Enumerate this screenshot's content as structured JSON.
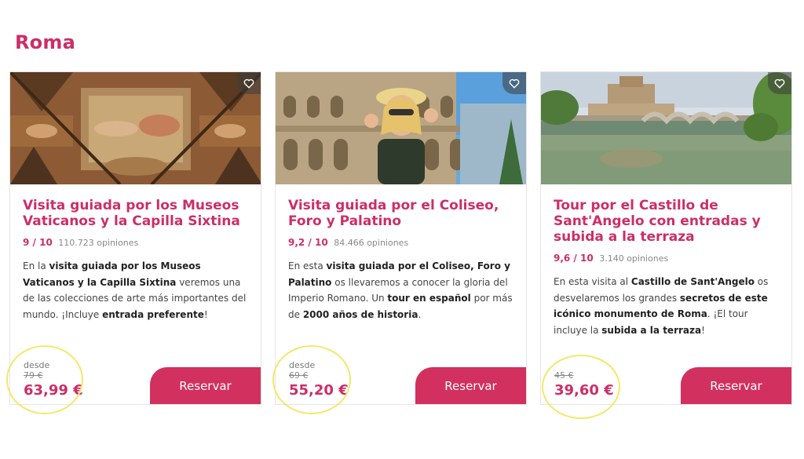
{
  "section": {
    "title": "Roma"
  },
  "cards": [
    {
      "title": "Visita guiada por los Museos Vaticanos y la Capilla Sixtina",
      "rating": "9 / 10",
      "reviews": "110.723 opiniones",
      "desc": [
        {
          "t": "En la ",
          "b": false
        },
        {
          "t": "visita guiada por los Museos Vaticanos y la Capilla Sixtina",
          "b": true
        },
        {
          "t": " veremos una de las colecciones de arte más importantes del mundo. ¡Incluye ",
          "b": false
        },
        {
          "t": "entrada preferente",
          "b": true
        },
        {
          "t": "!",
          "b": false
        }
      ],
      "price_from": "desde",
      "price_old": "79 €",
      "price_now": "63,99 €",
      "button": "Reservar"
    },
    {
      "title": "Visita guiada por el Coliseo, Foro y Palatino",
      "rating": "9,2 / 10",
      "reviews": "84.466 opiniones",
      "desc": [
        {
          "t": "En esta ",
          "b": false
        },
        {
          "t": "visita guiada por el Coliseo, Foro y Palatino",
          "b": true
        },
        {
          "t": " os llevaremos a conocer la gloria del Imperio Romano. Un ",
          "b": false
        },
        {
          "t": "tour en español",
          "b": true
        },
        {
          "t": " por más de ",
          "b": false
        },
        {
          "t": "2000 años de historia",
          "b": true
        },
        {
          "t": ".",
          "b": false
        }
      ],
      "price_from": "desde",
      "price_old": "69 €",
      "price_now": "55,20 €",
      "button": "Reservar"
    },
    {
      "title": "Tour por el Castillo de Sant'Angelo con entradas y subida a la terraza",
      "rating": "9,6 / 10",
      "reviews": "3.140 opiniones",
      "desc": [
        {
          "t": "En esta visita al ",
          "b": false
        },
        {
          "t": "Castillo de Sant'Angelo",
          "b": true
        },
        {
          "t": " os desvelaremos los grandes ",
          "b": false
        },
        {
          "t": "secretos de este icónico monumento de Roma",
          "b": true
        },
        {
          "t": ". ¡El tour incluye la ",
          "b": false
        },
        {
          "t": "subida a la terraza",
          "b": true
        },
        {
          "t": "!",
          "b": false
        }
      ],
      "price_from": "",
      "price_old": "45 €",
      "price_now": "39,60 €",
      "button": "Reservar"
    }
  ],
  "icons": {
    "favorite": "heart-outline-icon"
  },
  "colors": {
    "brand": "#cc2e68",
    "button": "#d2305f",
    "highlight": "#f3e86a"
  }
}
